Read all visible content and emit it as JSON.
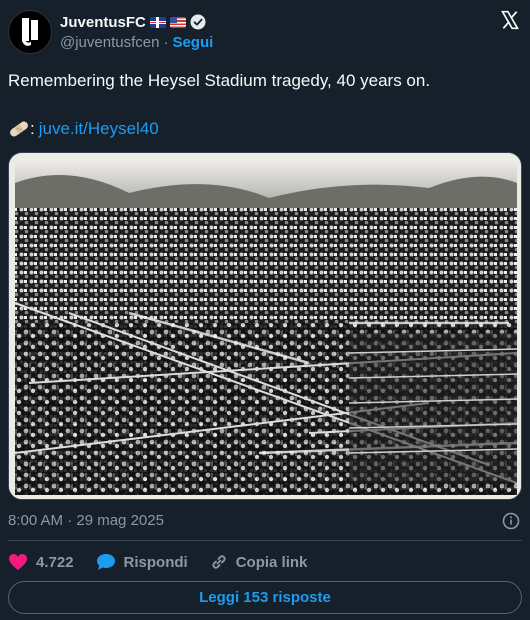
{
  "author": {
    "display_name": "JuventusFC",
    "handle": "@juventusfcen",
    "separator": "·",
    "follow_label": "Segui",
    "flags": [
      "uk-flag",
      "us-flag"
    ],
    "verified": true
  },
  "tweet": {
    "text": "Remembering the Heysel Stadium tragedy, 40 years on.",
    "link_prefix": ":",
    "link_icon": "bandage-icon",
    "link_text": "juve.it/Heysel40",
    "media": {
      "description": "black-and-white archival photo",
      "icon": "stadium-crowd-photo"
    }
  },
  "meta": {
    "timestamp": "8:00 AM · 29 mag 2025"
  },
  "actions": {
    "likes": "4.722",
    "reply_label": "Rispondi",
    "copy_link_label": "Copia link"
  },
  "read_replies_label": "Leggi 153 risposte",
  "colors": {
    "background": "#15202b",
    "accent": "#1d9bf0",
    "like": "#f91880",
    "muted": "#8b98a5"
  }
}
